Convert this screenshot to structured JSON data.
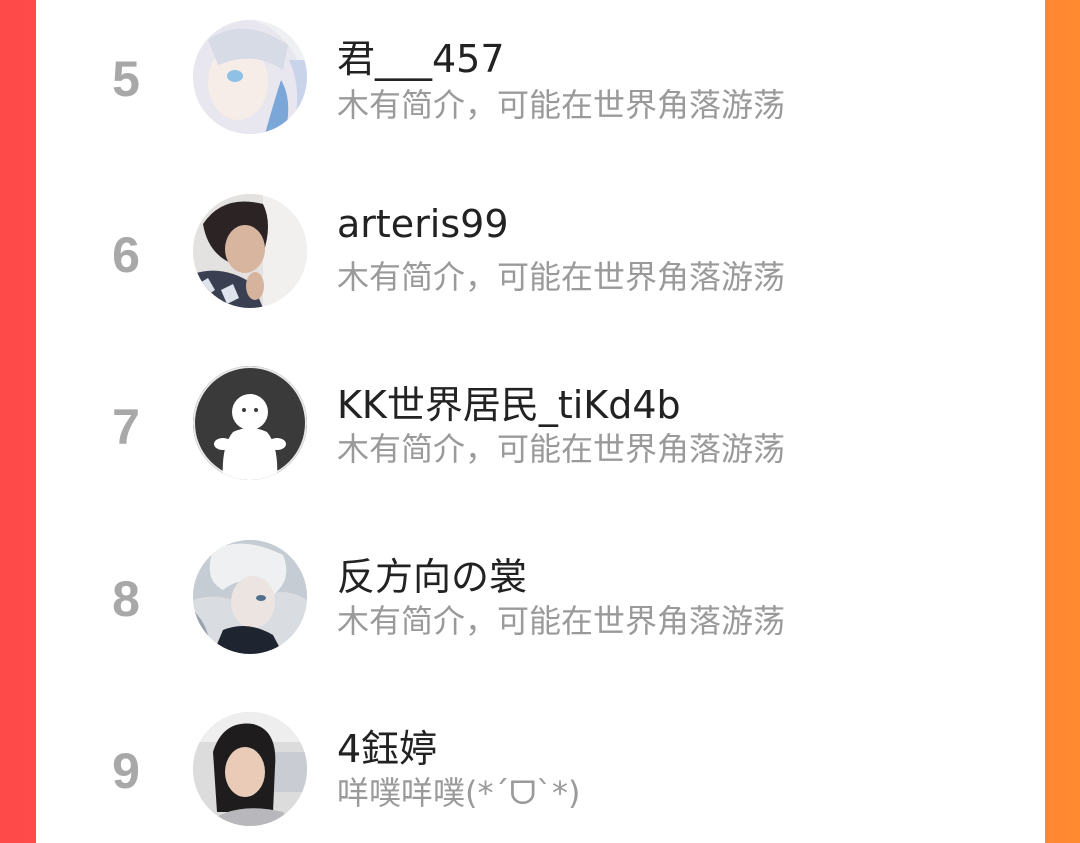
{
  "colors": {
    "background_left": "#ff4a4a",
    "background_right": "#ff8a30",
    "panel": "#ffffff",
    "rank_text": "#a8a8a8",
    "name_text": "#222222",
    "bio_text": "#9a9a9a"
  },
  "ranking": {
    "items": [
      {
        "rank": "5",
        "name": "君___457",
        "bio": "木有简介，可能在世界角落游荡",
        "avatar": "anime-girl-avatar"
      },
      {
        "rank": "6",
        "name": "arteris99",
        "bio": "木有简介，可能在世界角落游荡",
        "avatar": "photo-woman-avatar"
      },
      {
        "rank": "7",
        "name": "KK世界居民_tiKd4b",
        "bio": "木有简介，可能在世界角落游荡",
        "avatar": "default-user-avatar"
      },
      {
        "rank": "8",
        "name": "反方向の裳",
        "bio": "木有简介，可能在世界角落游荡",
        "avatar": "anime-boy-avatar"
      },
      {
        "rank": "9",
        "name": "4鈺婷",
        "bio": "咩噗咩噗(*ˊᗜˋ*)",
        "avatar": "photo-selfie-avatar"
      }
    ]
  }
}
